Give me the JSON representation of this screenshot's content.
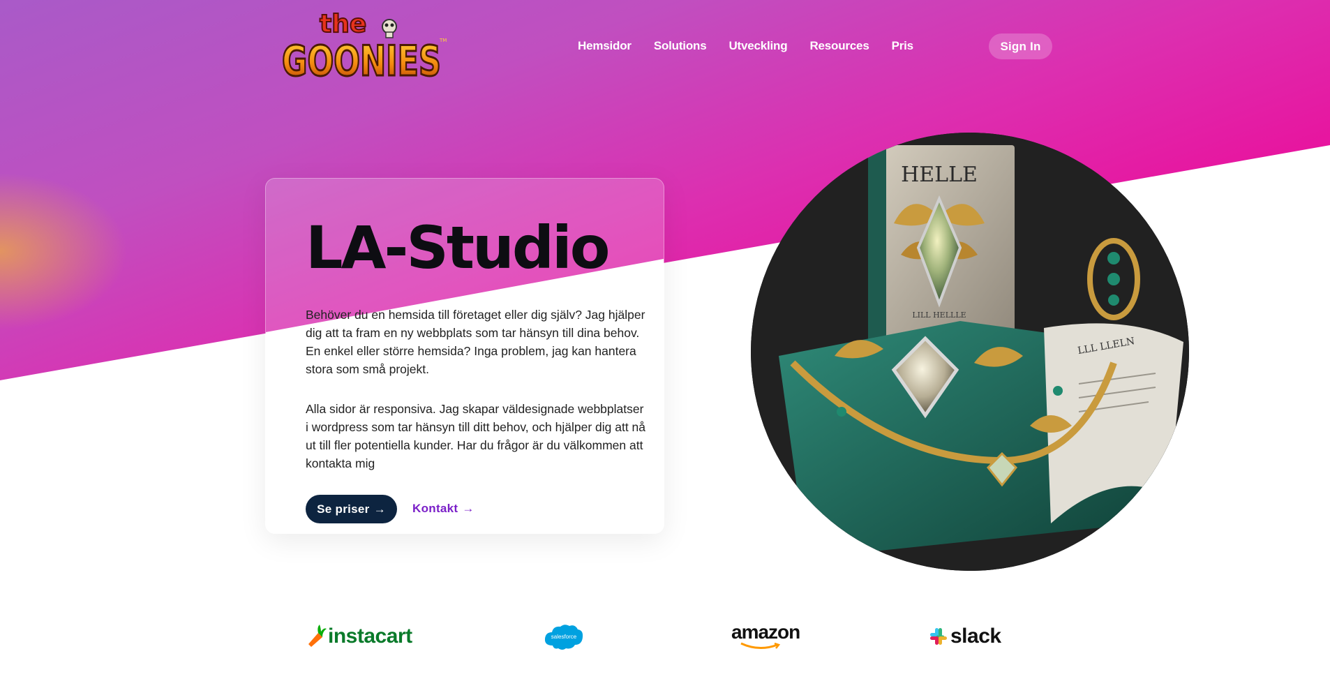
{
  "header": {
    "logo_top": "the",
    "logo_main": "GOONIES",
    "logo_tm": "TM",
    "nav": [
      "Hemsidor",
      "Solutions",
      "Utveckling",
      "Resources",
      "Pris"
    ],
    "signin_label": "Sign In"
  },
  "hero": {
    "title": "LA-Studio",
    "paragraph1": "Behöver du en hemsida till företaget eller dig själv? Jag hjälper dig att ta fram en ny webbplats som tar hänsyn till dina behov. En enkel eller större hemsida? Inga problem, jag kan hantera stora som små projekt.",
    "paragraph2": "Alla sidor är responsiva. Jag skapar väldesignade webbplatser i wordpress som tar hänsyn till ditt behov, och hjälper dig att nå ut till fler potentiella kunder. Har du frågor är du välkommen att kontakta mig",
    "primary_button": "Se priser",
    "secondary_link": "Kontakt",
    "arrow": "→",
    "image_book_title": "HELLE",
    "image_book_sub": "LILL HELLLE",
    "image_page_title": "LLL LLELN"
  },
  "brands": {
    "instacart": "instacart",
    "salesforce": "salesforce",
    "amazon": "amazon",
    "slack": "slack"
  },
  "colors": {
    "accent_magenta": "#ec0a98",
    "accent_purple": "#a95ac8",
    "primary_button": "#0d2440",
    "link_purple": "#7a1fc8",
    "instacart_green": "#0aad0a",
    "instacart_orange": "#ff7009",
    "salesforce_blue": "#00a1e0"
  }
}
